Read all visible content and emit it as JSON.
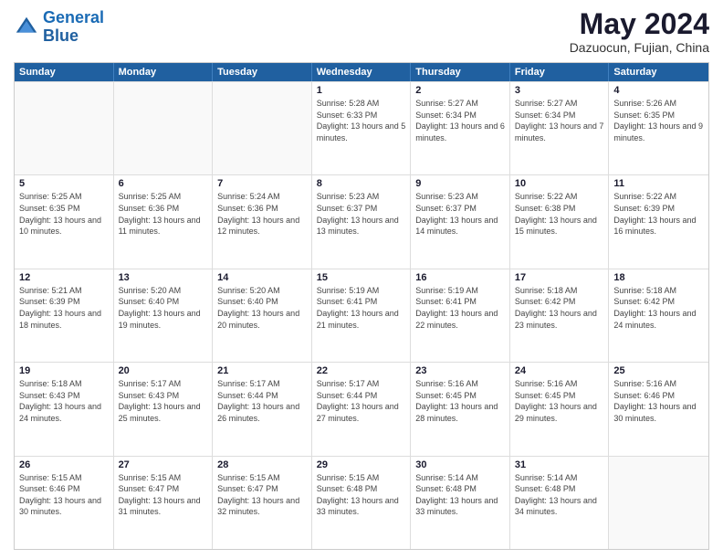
{
  "logo": {
    "line1": "General",
    "line2": "Blue"
  },
  "title": "May 2024",
  "subtitle": "Dazuocun, Fujian, China",
  "days_of_week": [
    "Sunday",
    "Monday",
    "Tuesday",
    "Wednesday",
    "Thursday",
    "Friday",
    "Saturday"
  ],
  "weeks": [
    [
      {
        "day": "",
        "sunrise": "",
        "sunset": "",
        "daylight": ""
      },
      {
        "day": "",
        "sunrise": "",
        "sunset": "",
        "daylight": ""
      },
      {
        "day": "",
        "sunrise": "",
        "sunset": "",
        "daylight": ""
      },
      {
        "day": "1",
        "sunrise": "5:28 AM",
        "sunset": "6:33 PM",
        "daylight": "13 hours and 5 minutes."
      },
      {
        "day": "2",
        "sunrise": "5:27 AM",
        "sunset": "6:34 PM",
        "daylight": "13 hours and 6 minutes."
      },
      {
        "day": "3",
        "sunrise": "5:27 AM",
        "sunset": "6:34 PM",
        "daylight": "13 hours and 7 minutes."
      },
      {
        "day": "4",
        "sunrise": "5:26 AM",
        "sunset": "6:35 PM",
        "daylight": "13 hours and 9 minutes."
      }
    ],
    [
      {
        "day": "5",
        "sunrise": "5:25 AM",
        "sunset": "6:35 PM",
        "daylight": "13 hours and 10 minutes."
      },
      {
        "day": "6",
        "sunrise": "5:25 AM",
        "sunset": "6:36 PM",
        "daylight": "13 hours and 11 minutes."
      },
      {
        "day": "7",
        "sunrise": "5:24 AM",
        "sunset": "6:36 PM",
        "daylight": "13 hours and 12 minutes."
      },
      {
        "day": "8",
        "sunrise": "5:23 AM",
        "sunset": "6:37 PM",
        "daylight": "13 hours and 13 minutes."
      },
      {
        "day": "9",
        "sunrise": "5:23 AM",
        "sunset": "6:37 PM",
        "daylight": "13 hours and 14 minutes."
      },
      {
        "day": "10",
        "sunrise": "5:22 AM",
        "sunset": "6:38 PM",
        "daylight": "13 hours and 15 minutes."
      },
      {
        "day": "11",
        "sunrise": "5:22 AM",
        "sunset": "6:39 PM",
        "daylight": "13 hours and 16 minutes."
      }
    ],
    [
      {
        "day": "12",
        "sunrise": "5:21 AM",
        "sunset": "6:39 PM",
        "daylight": "13 hours and 18 minutes."
      },
      {
        "day": "13",
        "sunrise": "5:20 AM",
        "sunset": "6:40 PM",
        "daylight": "13 hours and 19 minutes."
      },
      {
        "day": "14",
        "sunrise": "5:20 AM",
        "sunset": "6:40 PM",
        "daylight": "13 hours and 20 minutes."
      },
      {
        "day": "15",
        "sunrise": "5:19 AM",
        "sunset": "6:41 PM",
        "daylight": "13 hours and 21 minutes."
      },
      {
        "day": "16",
        "sunrise": "5:19 AM",
        "sunset": "6:41 PM",
        "daylight": "13 hours and 22 minutes."
      },
      {
        "day": "17",
        "sunrise": "5:18 AM",
        "sunset": "6:42 PM",
        "daylight": "13 hours and 23 minutes."
      },
      {
        "day": "18",
        "sunrise": "5:18 AM",
        "sunset": "6:42 PM",
        "daylight": "13 hours and 24 minutes."
      }
    ],
    [
      {
        "day": "19",
        "sunrise": "5:18 AM",
        "sunset": "6:43 PM",
        "daylight": "13 hours and 24 minutes."
      },
      {
        "day": "20",
        "sunrise": "5:17 AM",
        "sunset": "6:43 PM",
        "daylight": "13 hours and 25 minutes."
      },
      {
        "day": "21",
        "sunrise": "5:17 AM",
        "sunset": "6:44 PM",
        "daylight": "13 hours and 26 minutes."
      },
      {
        "day": "22",
        "sunrise": "5:17 AM",
        "sunset": "6:44 PM",
        "daylight": "13 hours and 27 minutes."
      },
      {
        "day": "23",
        "sunrise": "5:16 AM",
        "sunset": "6:45 PM",
        "daylight": "13 hours and 28 minutes."
      },
      {
        "day": "24",
        "sunrise": "5:16 AM",
        "sunset": "6:45 PM",
        "daylight": "13 hours and 29 minutes."
      },
      {
        "day": "25",
        "sunrise": "5:16 AM",
        "sunset": "6:46 PM",
        "daylight": "13 hours and 30 minutes."
      }
    ],
    [
      {
        "day": "26",
        "sunrise": "5:15 AM",
        "sunset": "6:46 PM",
        "daylight": "13 hours and 30 minutes."
      },
      {
        "day": "27",
        "sunrise": "5:15 AM",
        "sunset": "6:47 PM",
        "daylight": "13 hours and 31 minutes."
      },
      {
        "day": "28",
        "sunrise": "5:15 AM",
        "sunset": "6:47 PM",
        "daylight": "13 hours and 32 minutes."
      },
      {
        "day": "29",
        "sunrise": "5:15 AM",
        "sunset": "6:48 PM",
        "daylight": "13 hours and 33 minutes."
      },
      {
        "day": "30",
        "sunrise": "5:14 AM",
        "sunset": "6:48 PM",
        "daylight": "13 hours and 33 minutes."
      },
      {
        "day": "31",
        "sunrise": "5:14 AM",
        "sunset": "6:48 PM",
        "daylight": "13 hours and 34 minutes."
      },
      {
        "day": "",
        "sunrise": "",
        "sunset": "",
        "daylight": ""
      }
    ]
  ]
}
